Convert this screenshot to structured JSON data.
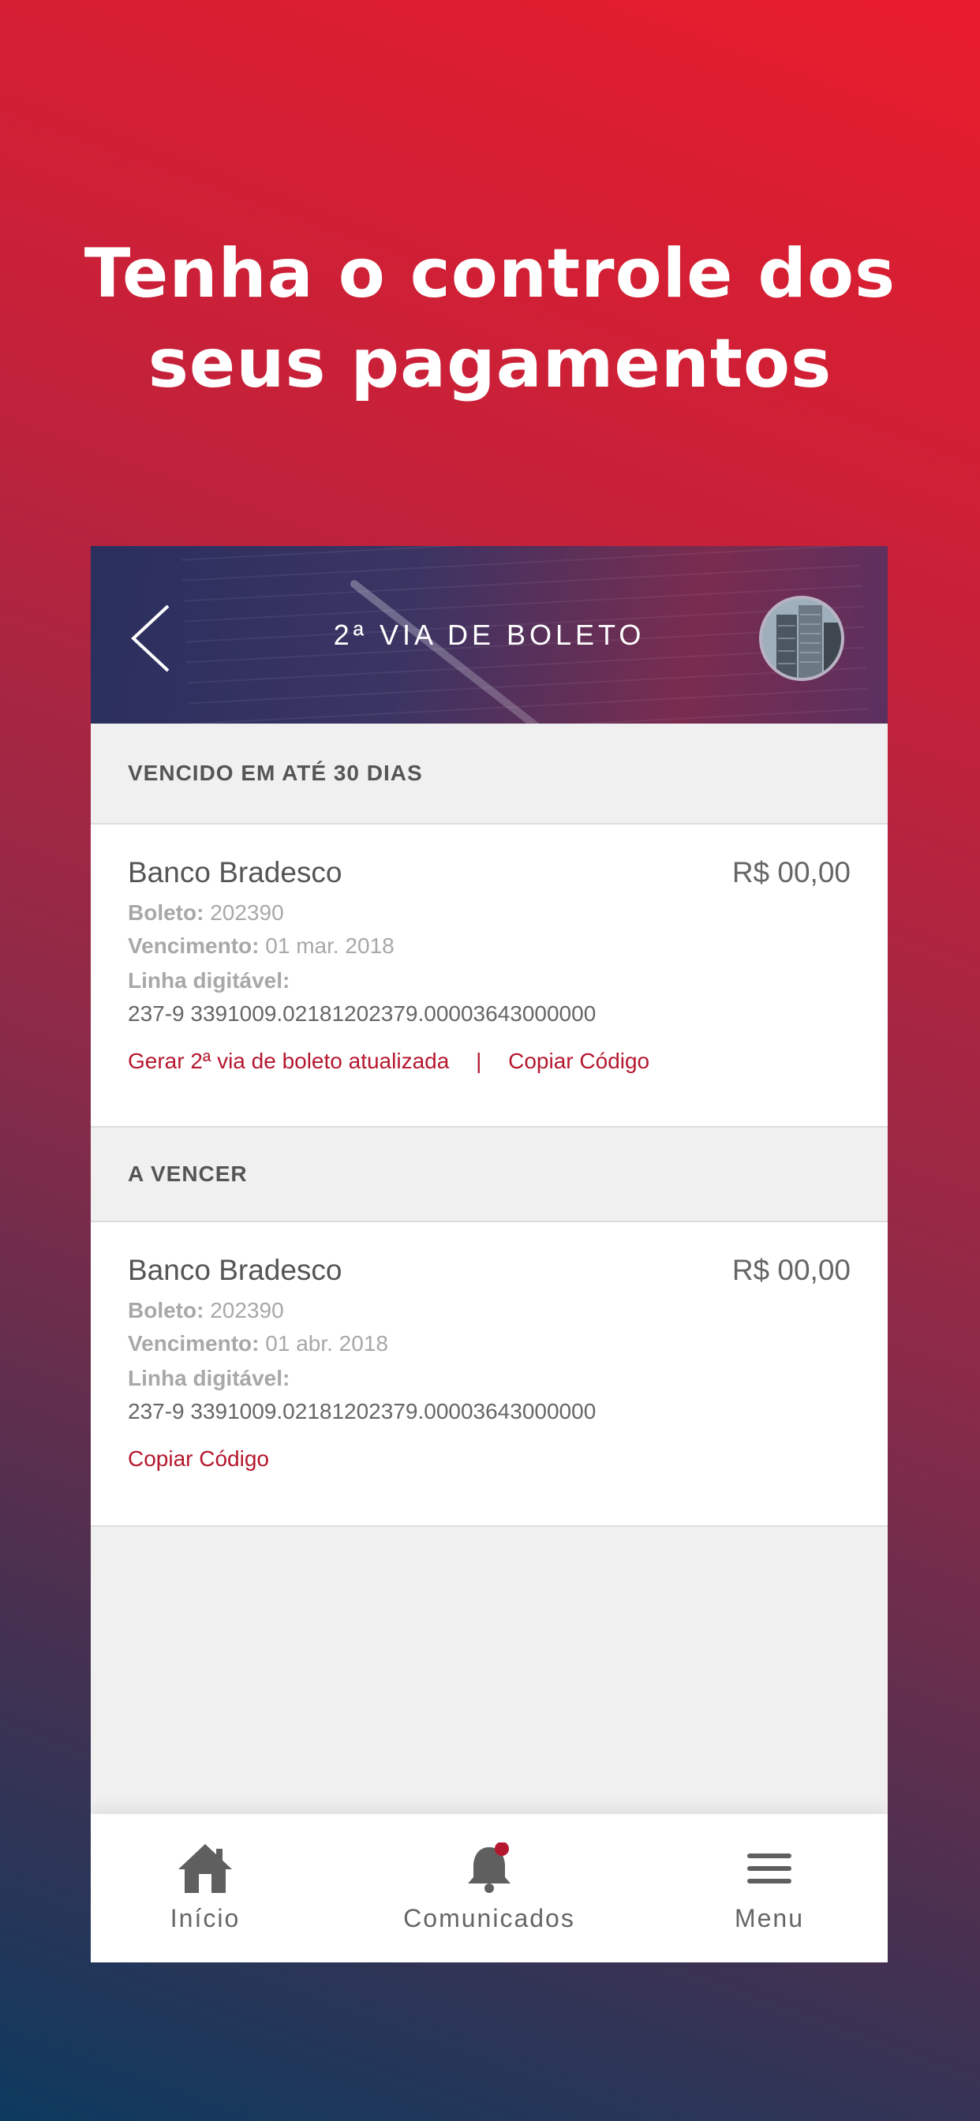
{
  "hero": {
    "title_line1": "Tenha o controle dos",
    "title_line2": "seus pagamentos"
  },
  "header": {
    "title": "2ª VIA DE BOLETO",
    "back_icon": "chevron-left-icon",
    "avatar": "building-avatar"
  },
  "sections": [
    {
      "heading": "VENCIDO EM ATÉ 30 DIAS",
      "item": {
        "bank": "Banco Bradesco",
        "amount": "R$ 00,00",
        "boleto_label": "Boleto:",
        "boleto_value": "202390",
        "vencimento_label": "Vencimento:",
        "vencimento_value": "01 mar. 2018",
        "linha_label": "Linha digitável:",
        "linha_value": "237-9 3391009.02181202379.00003643000000",
        "link_gerar": "Gerar 2ª via de boleto atualizada",
        "separator": "|",
        "link_copiar": "Copiar Código"
      }
    },
    {
      "heading": "A VENCER",
      "item": {
        "bank": "Banco Bradesco",
        "amount": "R$ 00,00",
        "boleto_label": "Boleto:",
        "boleto_value": "202390",
        "vencimento_label": "Vencimento:",
        "vencimento_value": "01 abr. 2018",
        "linha_label": "Linha digitável:",
        "linha_value": "237-9 3391009.02181202379.00003643000000",
        "link_copiar": "Copiar Código"
      }
    }
  ],
  "tabbar": {
    "items": [
      {
        "label": "Início",
        "icon": "home-icon"
      },
      {
        "label": "Comunicados",
        "icon": "bell-icon",
        "badge": true
      },
      {
        "label": "Menu",
        "icon": "hamburger-menu-icon"
      }
    ]
  },
  "colors": {
    "accent": "#b5172e",
    "badge": "#b5172e"
  }
}
